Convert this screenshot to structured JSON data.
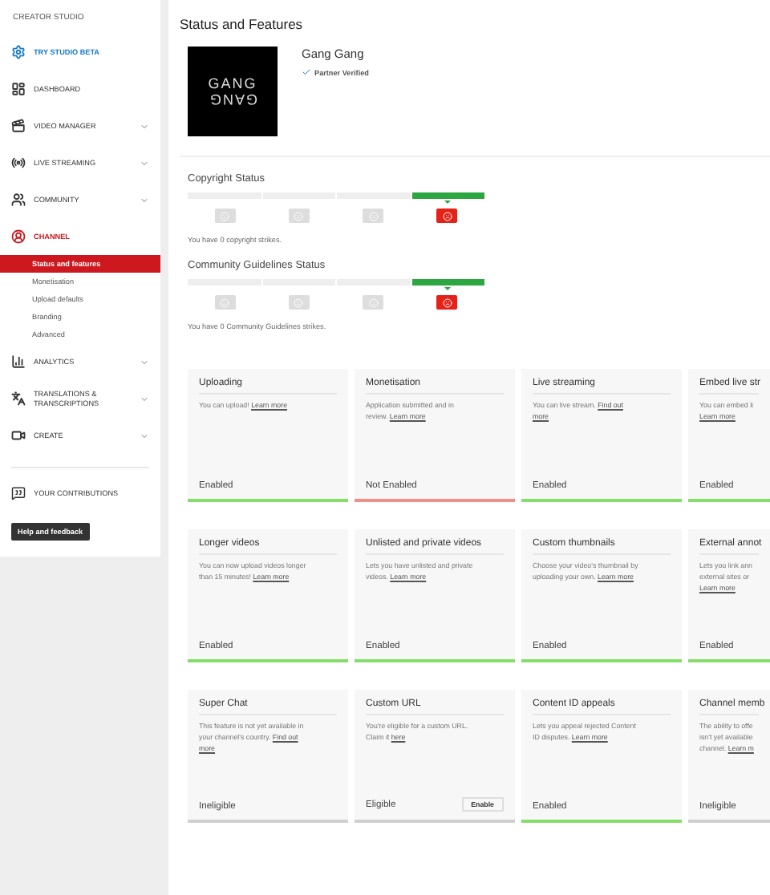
{
  "sidebar": {
    "title": "CREATOR STUDIO",
    "items": [
      {
        "kind": "beta",
        "label": "TRY STUDIO BETA",
        "expandable": false,
        "selected": false
      },
      {
        "kind": "dashboard",
        "label": "DASHBOARD",
        "expandable": false,
        "selected": false
      },
      {
        "kind": "videos",
        "label": "VIDEO MANAGER",
        "expandable": true,
        "selected": false
      },
      {
        "kind": "live",
        "label": "LIVE STREAMING",
        "expandable": true,
        "selected": false
      },
      {
        "kind": "community",
        "label": "COMMUNITY",
        "expandable": true,
        "selected": false
      },
      {
        "kind": "channel",
        "label": "CHANNEL",
        "expandable": false,
        "selected": true,
        "children": [
          {
            "label": "Status and features",
            "selected": true
          },
          {
            "label": "Monetisation",
            "selected": false
          },
          {
            "label": "Upload defaults",
            "selected": false
          },
          {
            "label": "Branding",
            "selected": false
          },
          {
            "label": "Advanced",
            "selected": false
          }
        ]
      },
      {
        "kind": "analytics",
        "label": "ANALYTICS",
        "expandable": true,
        "selected": false
      },
      {
        "kind": "translate",
        "label": "TRANSLATIONS & TRANSCRIPTIONS",
        "expandable": true,
        "selected": false
      },
      {
        "kind": "create",
        "label": "CREATE",
        "expandable": true,
        "selected": false
      }
    ],
    "footer_item": {
      "label": "YOUR CONTRIBUTIONS"
    },
    "help_button": "Help and feedback"
  },
  "page_title": "Status and Features",
  "channel": {
    "logo_lines": [
      "GANG",
      "GANG"
    ],
    "name": "Gang Gang",
    "badge": "Partner Verified"
  },
  "statuses": [
    {
      "title": "Copyright Status",
      "segments": [
        {
          "selected": false
        },
        {
          "selected": false
        },
        {
          "selected": false
        },
        {
          "selected": true
        }
      ],
      "note": "You have 0 copyright strikes."
    },
    {
      "title": "Community Guidelines Status",
      "segments": [
        {
          "selected": false
        },
        {
          "selected": false
        },
        {
          "selected": false
        },
        {
          "selected": true
        }
      ],
      "note": "You have 0 Community Guidelines strikes."
    }
  ],
  "features": [
    {
      "title": "Uploading",
      "lines": [
        [
          {
            "kind": "text",
            "text": "You can upload! "
          },
          {
            "kind": "link",
            "text": "Learn more"
          }
        ]
      ],
      "status": "Enabled",
      "color": "#85de6a"
    },
    {
      "title": "Monetisation",
      "lines": [
        [
          {
            "kind": "text",
            "text": "Application submitted and in"
          }
        ],
        [
          {
            "kind": "text",
            "text": "review. "
          },
          {
            "kind": "link",
            "text": "Learn more"
          }
        ]
      ],
      "status": "Not Enabled",
      "color": "#f08f86"
    },
    {
      "title": "Live streaming",
      "lines": [
        [
          {
            "kind": "text",
            "text": "You can live stream. "
          },
          {
            "kind": "link",
            "text": "Find out"
          }
        ],
        [
          {
            "kind": "link",
            "text": "more"
          }
        ]
      ],
      "status": "Enabled",
      "color": "#85de6a"
    },
    {
      "title": "Embed live str",
      "lines": [
        [
          {
            "kind": "text",
            "text": "You can embed li"
          }
        ],
        [
          {
            "kind": "link",
            "text": "Learn more"
          }
        ]
      ],
      "status": "Enabled",
      "color": "#85de6a"
    },
    {
      "title": "Longer videos",
      "lines": [
        [
          {
            "kind": "text",
            "text": "You can now upload videos longer"
          }
        ],
        [
          {
            "kind": "text",
            "text": "than 15 minutes! "
          },
          {
            "kind": "link",
            "text": "Learn more"
          }
        ]
      ],
      "status": "Enabled",
      "color": "#85de6a"
    },
    {
      "title": "Unlisted and private videos",
      "lines": [
        [
          {
            "kind": "text",
            "text": "Lets you have unlisted and private"
          }
        ],
        [
          {
            "kind": "text",
            "text": "videos. "
          },
          {
            "kind": "link",
            "text": "Learn more"
          }
        ]
      ],
      "status": "Enabled",
      "color": "#85de6a"
    },
    {
      "title": "Custom thumbnails",
      "lines": [
        [
          {
            "kind": "text",
            "text": "Choose your video's thumbnail by"
          }
        ],
        [
          {
            "kind": "text",
            "text": "uploading your own. "
          },
          {
            "kind": "link",
            "text": "Learn more"
          }
        ]
      ],
      "status": "Enabled",
      "color": "#85de6a"
    },
    {
      "title": "External annot",
      "lines": [
        [
          {
            "kind": "text",
            "text": "Lets you link ann"
          }
        ],
        [
          {
            "kind": "text",
            "text": "external sites or"
          }
        ],
        [
          {
            "kind": "link",
            "text": "Learn more"
          }
        ]
      ],
      "status": "Enabled",
      "color": "#85de6a"
    },
    {
      "title": "Super Chat",
      "lines": [
        [
          {
            "kind": "text",
            "text": "This feature is not yet available in"
          }
        ],
        [
          {
            "kind": "text",
            "text": "your channel's country. "
          },
          {
            "kind": "link",
            "text": "Find out"
          }
        ],
        [
          {
            "kind": "link",
            "text": "more"
          }
        ]
      ],
      "status": "Ineligible",
      "color": "#cfcfcf"
    },
    {
      "title": "Custom URL",
      "lines": [
        [
          {
            "kind": "text",
            "text": "You're eligible for a custom URL."
          }
        ],
        [
          {
            "kind": "text",
            "text": "Claim it "
          },
          {
            "kind": "link",
            "text": "here"
          }
        ]
      ],
      "status": "Eligible",
      "color": "#cfcfcf",
      "action": "Enable"
    },
    {
      "title": "Content ID appeals",
      "lines": [
        [
          {
            "kind": "text",
            "text": "Lets you appeal rejected Content"
          }
        ],
        [
          {
            "kind": "text",
            "text": "ID disputes. "
          },
          {
            "kind": "link",
            "text": "Learn more"
          }
        ]
      ],
      "status": "Enabled",
      "color": "#85de6a"
    },
    {
      "title": "Channel memb",
      "lines": [
        [
          {
            "kind": "text",
            "text": "The ability to offe"
          }
        ],
        [
          {
            "kind": "text",
            "text": "isn't yet available"
          }
        ],
        [
          {
            "kind": "text",
            "text": "channel. "
          },
          {
            "kind": "link",
            "text": "Learn m"
          }
        ]
      ],
      "status": "Ineligible",
      "color": "#cfcfcf"
    }
  ]
}
